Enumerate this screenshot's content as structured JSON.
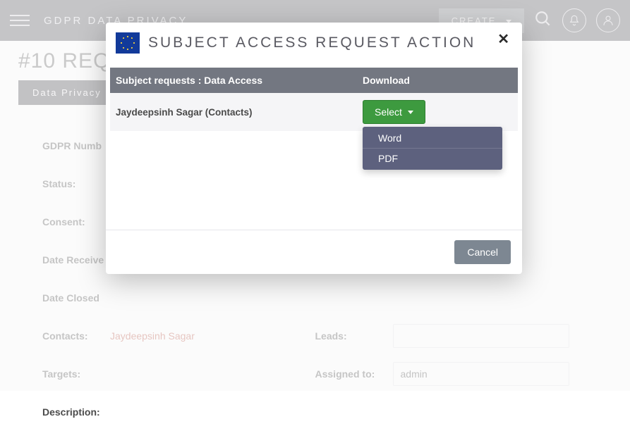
{
  "topbar": {
    "brand": "GDPR DATA PRIVACY",
    "create_label": "CREATE"
  },
  "page": {
    "title_prefix": "#10 REQ",
    "tab_label": "Data Privacy",
    "labels": {
      "gdpr_number": "GDPR Numb",
      "status": "Status:",
      "consent": "Consent:",
      "date_received": "Date Receive",
      "date_closed": "Date Closed",
      "contacts": "Contacts:",
      "targets": "Targets:",
      "description": "Description:",
      "leads": "Leads:",
      "assigned_to": "Assigned to:"
    },
    "values": {
      "contacts": "Jaydeepsinh Sagar",
      "assigned_to": "admin"
    }
  },
  "modal": {
    "title": "SUBJECT ACCESS REQUEST ACTION",
    "headers": {
      "subject": "Subject requests : Data Access",
      "download": "Download"
    },
    "row": {
      "name": "Jaydeepsinh Sagar (Contacts)"
    },
    "select_label": "Select",
    "options": {
      "word": "Word",
      "pdf": "PDF"
    },
    "cancel_label": "Cancel"
  }
}
